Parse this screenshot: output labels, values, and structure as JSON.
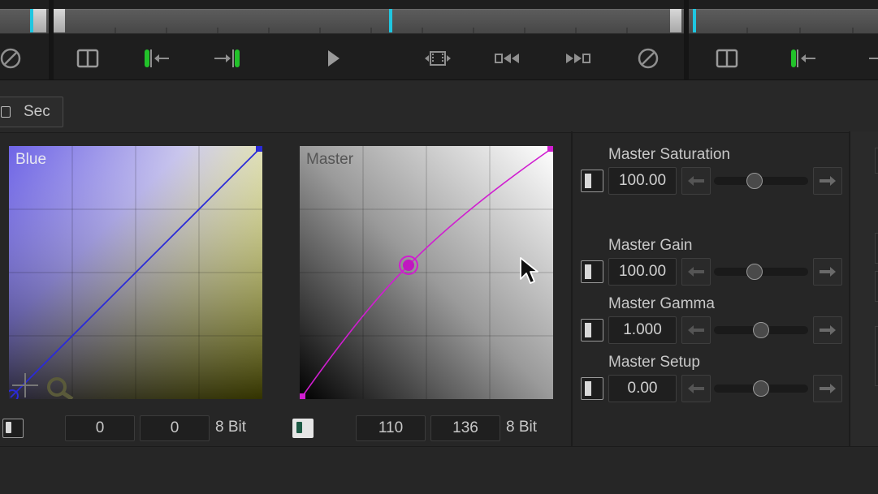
{
  "toolbar_row": {
    "sec_label": "Sec"
  },
  "curves": {
    "blue": {
      "label": "Blue",
      "in_value": "0",
      "out_value": "0",
      "bit_label": "8 Bit"
    },
    "master": {
      "label": "Master",
      "in_value": "110",
      "out_value": "136",
      "bit_label": "8 Bit"
    }
  },
  "master_controls": [
    {
      "label": "Master Saturation",
      "value": "100.00"
    },
    {
      "label": "Master Gain",
      "value": "100.00"
    },
    {
      "label": "Master Gamma",
      "value": "1.000"
    },
    {
      "label": "Master Setup",
      "value": "0.00"
    }
  ],
  "icons": {
    "timeline": [
      "disable-icon",
      "split-view-icon",
      "mark-in-icon",
      "mark-out-icon",
      "play-icon",
      "fit-clip-icon",
      "go-to-start-icon",
      "go-to-end-icon",
      "disable-icon",
      "split-view-icon",
      "mark-in-icon"
    ],
    "arrows": [
      "arrow-left-icon",
      "arrow-right-icon"
    ],
    "cursor": "mouse-pointer-icon",
    "zoom": "magnifier-icon"
  },
  "colors": {
    "accent_cyan": "#1fc6e0",
    "mark_green": "#22c22a",
    "blue_curve": "#2b2bd8",
    "master_curve": "#d01ed0",
    "toggle_on": "#1d5a45"
  }
}
